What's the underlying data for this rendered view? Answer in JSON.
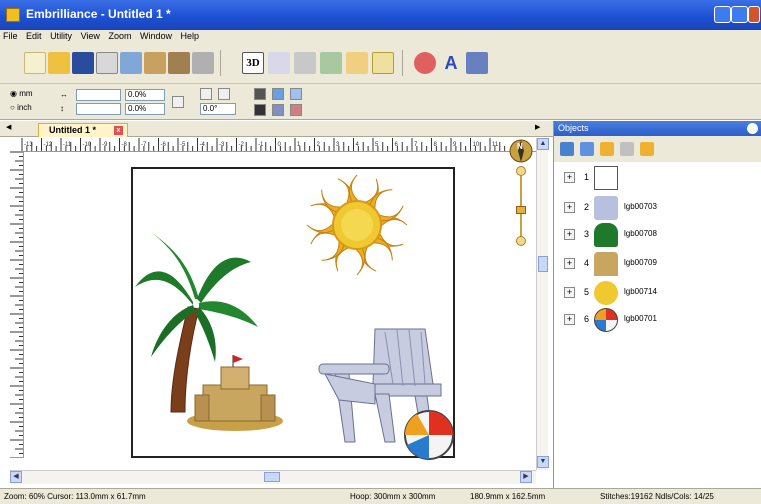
{
  "window": {
    "title": "Embrilliance - Untitled 1 *"
  },
  "menu": [
    "File",
    "Edit",
    "Utility",
    "View",
    "Zoom",
    "Window",
    "Help"
  ],
  "toolbar": {
    "view3d_label": "3D",
    "text_tool_label": "A"
  },
  "units": {
    "mm_label": "mm",
    "inch_label": "inch"
  },
  "fields": {
    "scale_w": "0.0%",
    "scale_h": "0.0%",
    "rotation": "0.0°",
    "width_value": "",
    "height_value": ""
  },
  "tabs": {
    "prev_arrow": "◀",
    "next_arrow": "▶",
    "document_tab": "Untitled 1 *",
    "close_glyph": "x"
  },
  "ruler_h_labels": [
    "-13",
    "-12",
    "-11",
    "-10",
    "-9",
    "-8",
    "-7",
    "-6",
    "-5",
    "-4",
    "-3",
    "-2",
    "-1",
    "0",
    "1",
    "2",
    "3",
    "4",
    "5",
    "6",
    "7",
    "8",
    "9",
    "10",
    "11",
    "12",
    "1"
  ],
  "compass": {
    "north_label": "N"
  },
  "objects_panel": {
    "title": "Objects",
    "items": [
      {
        "num": "1",
        "name": ""
      },
      {
        "num": "2",
        "name": "lgb00703"
      },
      {
        "num": "3",
        "name": "lgb00708"
      },
      {
        "num": "4",
        "name": "lgb00709"
      },
      {
        "num": "5",
        "name": "lgb00714"
      },
      {
        "num": "6",
        "name": "lgb00701"
      }
    ]
  },
  "status": {
    "zoom_cursor": "Zoom: 60%  Cursor: 113.0mm x 61.7mm",
    "hoop": "Hoop: 300mm x 300mm",
    "size": "180.9mm x 162.5mm",
    "stitches": "Stitches:19162  Ndls/Cols: 14/25"
  },
  "colors": {
    "titlebar": "#1c4fd1",
    "panel_header": "#2c5fc8",
    "chrome": "#ece9d8",
    "tab_active": "#fff4c8"
  }
}
